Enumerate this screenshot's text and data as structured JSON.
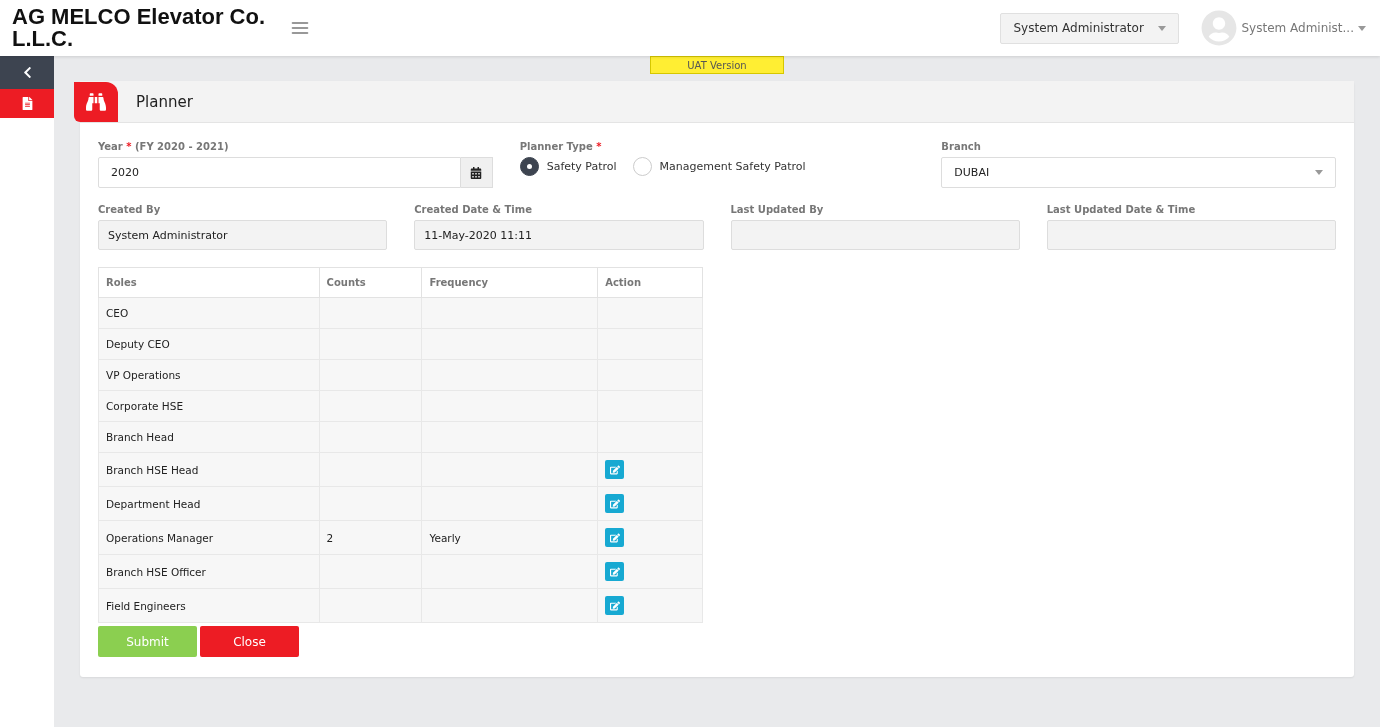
{
  "header": {
    "brand": "AG MELCO Elevator Co. L.L.C.",
    "role_select": "System Administrator",
    "user_name": "System Administ..."
  },
  "environment_badge": "UAT Version",
  "sidebar": {
    "items": [
      {
        "kind": "collapse"
      },
      {
        "kind": "document",
        "selected": true
      }
    ]
  },
  "panel": {
    "title": "Planner"
  },
  "year": {
    "label": "Year",
    "required_mark": "*",
    "hint": "(FY 2020 - 2021)",
    "value": "2020"
  },
  "planner_type": {
    "label": "Planner Type",
    "required_mark": "*",
    "options": [
      {
        "label": "Safety Patrol",
        "selected": true
      },
      {
        "label": "Management Safety Patrol",
        "selected": false
      }
    ]
  },
  "branch": {
    "label": "Branch",
    "value": "DUBAI"
  },
  "info_fields": [
    {
      "label": "Created By",
      "value": "System Administrator"
    },
    {
      "label": "Created Date & Time",
      "value": "11-May-2020 11:11"
    },
    {
      "label": "Last Updated By"
    },
    {
      "label": "Last Updated Date & Time"
    }
  ],
  "table": {
    "columns": [
      "Roles",
      "Counts",
      "Frequency",
      "Action"
    ],
    "rows": [
      {
        "role": "CEO",
        "editable": false
      },
      {
        "role": "Deputy CEO",
        "editable": false
      },
      {
        "role": "VP Operations",
        "editable": false
      },
      {
        "role": "Corporate HSE",
        "editable": false
      },
      {
        "role": "Branch Head",
        "editable": false
      },
      {
        "role": "Branch HSE Head",
        "editable": true
      },
      {
        "role": "Department Head",
        "editable": true
      },
      {
        "role": "Operations Manager",
        "count": "2",
        "frequency": "Yearly",
        "editable": true
      },
      {
        "role": "Branch HSE Officer",
        "editable": true
      },
      {
        "role": "Field Engineers",
        "editable": true
      }
    ]
  },
  "buttons": [
    {
      "kind": "submit",
      "label": "Submit"
    },
    {
      "kind": "close",
      "label": "Close"
    }
  ]
}
